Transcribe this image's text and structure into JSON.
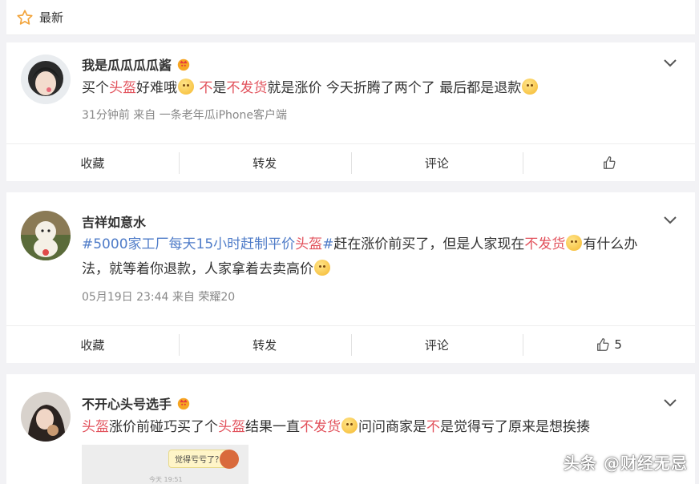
{
  "header": {
    "label": "最新",
    "icon": "star-icon"
  },
  "posts": [
    {
      "user": "我是瓜瓜瓜瓜酱",
      "content": [
        {
          "t": "买个",
          "c": "n"
        },
        {
          "t": "头盔",
          "c": "r"
        },
        {
          "t": "好难哦",
          "c": "n"
        },
        {
          "t": "",
          "c": "e"
        },
        {
          "t": " ",
          "c": "n"
        },
        {
          "t": "不",
          "c": "r"
        },
        {
          "t": "是",
          "c": "n"
        },
        {
          "t": "不发货",
          "c": "r"
        },
        {
          "t": "就是涨价 今天折腾了两个了 最后都是退款",
          "c": "n"
        },
        {
          "t": "",
          "c": "e"
        }
      ],
      "meta": "31分钟前   来自 一条老年瓜iPhone客户端",
      "actions": [
        "收藏",
        "转发",
        "评论",
        ""
      ]
    },
    {
      "user": "吉祥如意水",
      "content": [
        {
          "t": "#5000家工厂每天15小时赶制平价",
          "c": "t"
        },
        {
          "t": "头盔",
          "c": "r"
        },
        {
          "t": "#",
          "c": "t"
        },
        {
          "t": "赶在涨价前买了，但是人家现在",
          "c": "n"
        },
        {
          "t": "不发货",
          "c": "r"
        },
        {
          "t": "",
          "c": "e"
        },
        {
          "t": "有什么办法，就等着你退款，人家拿着去卖高价",
          "c": "n"
        },
        {
          "t": "",
          "c": "e"
        }
      ],
      "meta": "05月19日 23:44   来自 荣耀20",
      "actions": [
        "收藏",
        "转发",
        "评论",
        "5"
      ]
    },
    {
      "user": "不开心头号选手",
      "content": [
        {
          "t": "头盔",
          "c": "r"
        },
        {
          "t": "涨价前碰巧买了个",
          "c": "n"
        },
        {
          "t": "头盔",
          "c": "r"
        },
        {
          "t": "结果一直",
          "c": "n"
        },
        {
          "t": "不发货",
          "c": "r"
        },
        {
          "t": "",
          "c": "e"
        },
        {
          "t": "问问商家是",
          "c": "n"
        },
        {
          "t": "不",
          "c": "r"
        },
        {
          "t": "是觉得亏了原来是想挨揍",
          "c": "n"
        }
      ],
      "image": {
        "bubble": "觉得亏亏了？",
        "date": "今天 19:51"
      }
    }
  ],
  "watermark": "头条 @财经无忌",
  "colors": {
    "highlight": "#e2525c",
    "topic": "#4f7cc8",
    "text": "#333333",
    "meta": "#888888"
  }
}
